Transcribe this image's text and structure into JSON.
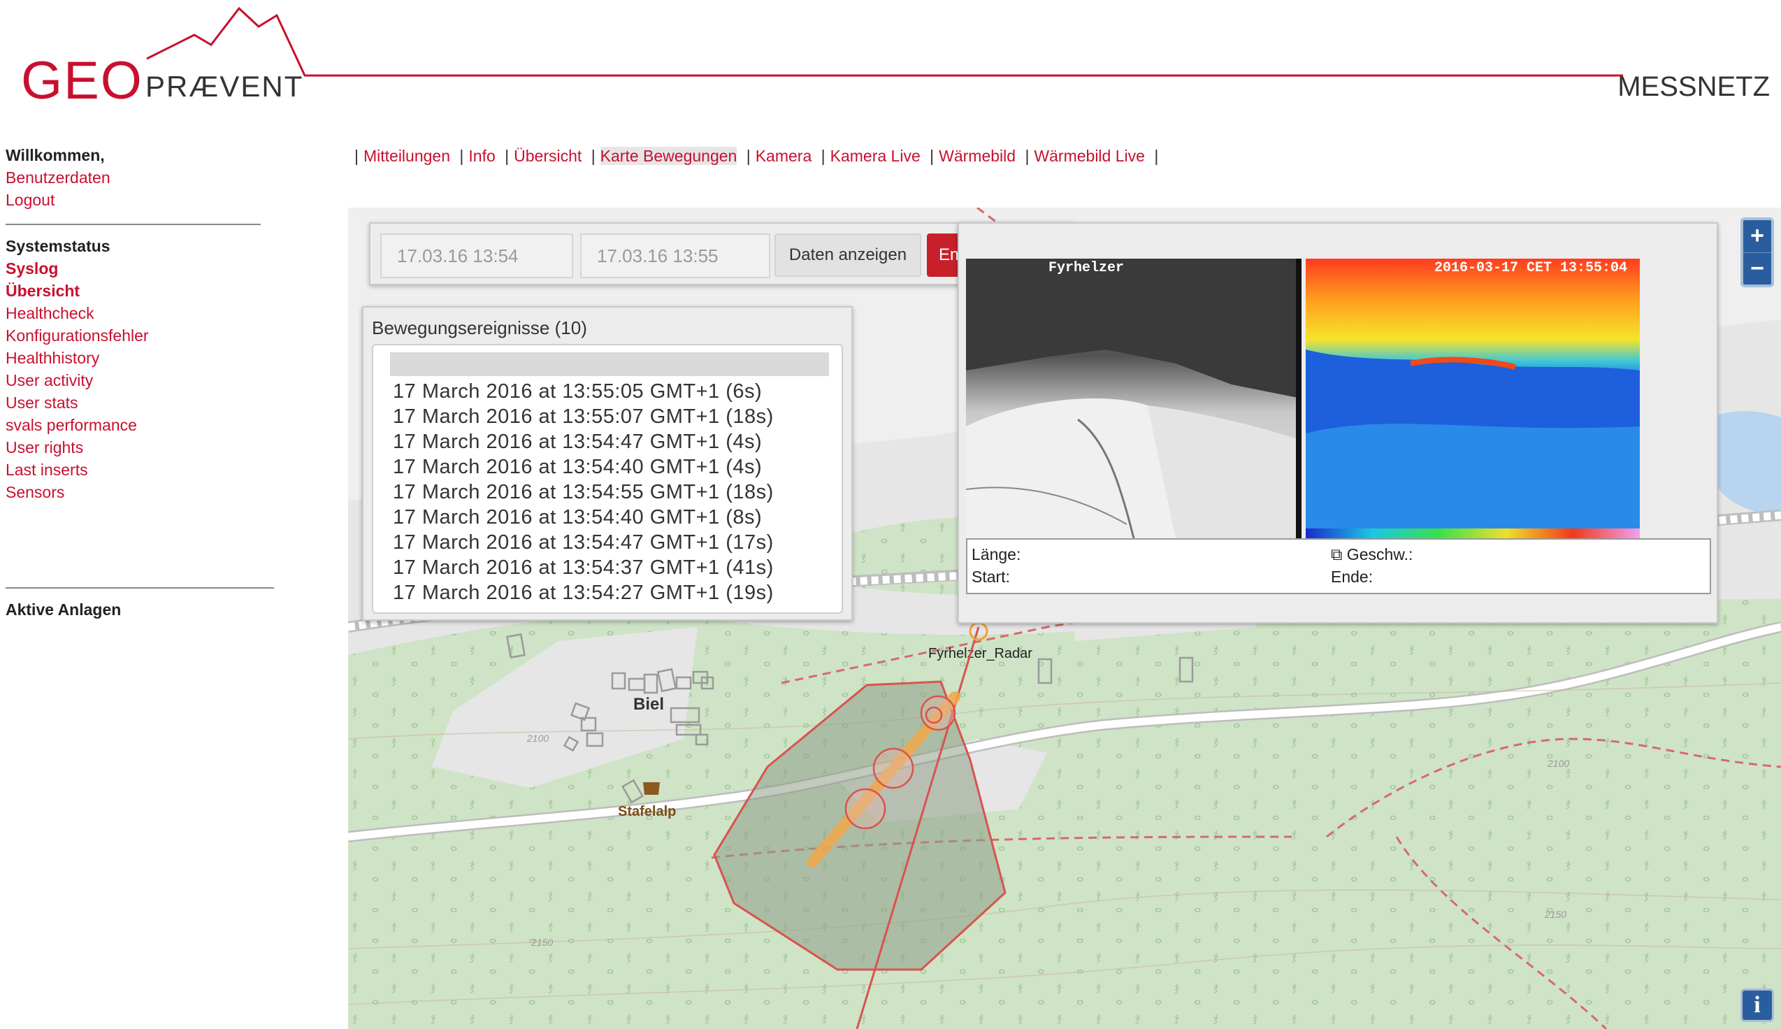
{
  "header": {
    "logo_geo": "GEO",
    "logo_praevent": "PRÆVENT",
    "brand_right": "MESSNETZ"
  },
  "sidebar": {
    "welcome": "Willkommen,",
    "links": [
      "Benutzerdaten",
      "Logout"
    ],
    "status_heading": "Systemstatus",
    "status_links": [
      "Syslog",
      "Übersicht",
      "Healthcheck",
      "Konfigurationsfehler",
      "Healthhistory",
      "User activity",
      "User stats",
      "svals performance",
      "User rights",
      "Last inserts",
      "Sensors"
    ],
    "active_heading": "Aktive Anlagen"
  },
  "nav": {
    "items": [
      "Mitteilungen",
      "Info",
      "Übersicht",
      "Karte Bewegungen",
      "Kamera",
      "Kamera Live",
      "Wärmebild",
      "Wärmebild Live"
    ],
    "active": "Karte Bewegungen",
    "separator": "|"
  },
  "controls": {
    "from_value": "17.03.16 13:54",
    "to_value": "17.03.16 13:55",
    "show_button": "Daten anzeigen",
    "receive_button": "Empfange...",
    "receive_icon": "refresh-icon"
  },
  "events": {
    "title": "Bewegungsereignisse (10)",
    "rows": [
      "17 March 2016 at 13:55:05 GMT+1 (6s)",
      "17 March 2016 at 13:55:07 GMT+1 (18s)",
      "17 March 2016 at 13:54:47 GMT+1 (4s)",
      "17 March 2016 at 13:54:40 GMT+1 (4s)",
      "17 March 2016 at 13:54:55 GMT+1 (18s)",
      "17 March 2016 at 13:54:40 GMT+1 (8s)",
      "17 March 2016 at 13:54:47 GMT+1 (17s)",
      "17 March 2016 at 13:54:37 GMT+1 (41s)",
      "17 March 2016 at 13:54:27 GMT+1 (19s)"
    ]
  },
  "camera": {
    "gray_label": "Fyrhelzer",
    "thermal_label": "2016-03-17 CET 13:55:04",
    "length_label": "Länge:",
    "start_label": "Start:",
    "speed_label": "⧉ Geschw.:",
    "end_label": "Ende:"
  },
  "map": {
    "labels": {
      "radar": "Fyrhelzer_Radar",
      "village": "Biel",
      "alp": "Stafelalp",
      "contour_2100": "2100",
      "contour_2150": "2150"
    },
    "zoom_in": "+",
    "zoom_out": "−",
    "info": "i"
  },
  "colors": {
    "accent": "#c8102e",
    "forest": "#cfe3c7",
    "button_red": "#c8202a",
    "zoom_blue": "#2a5d9e"
  }
}
